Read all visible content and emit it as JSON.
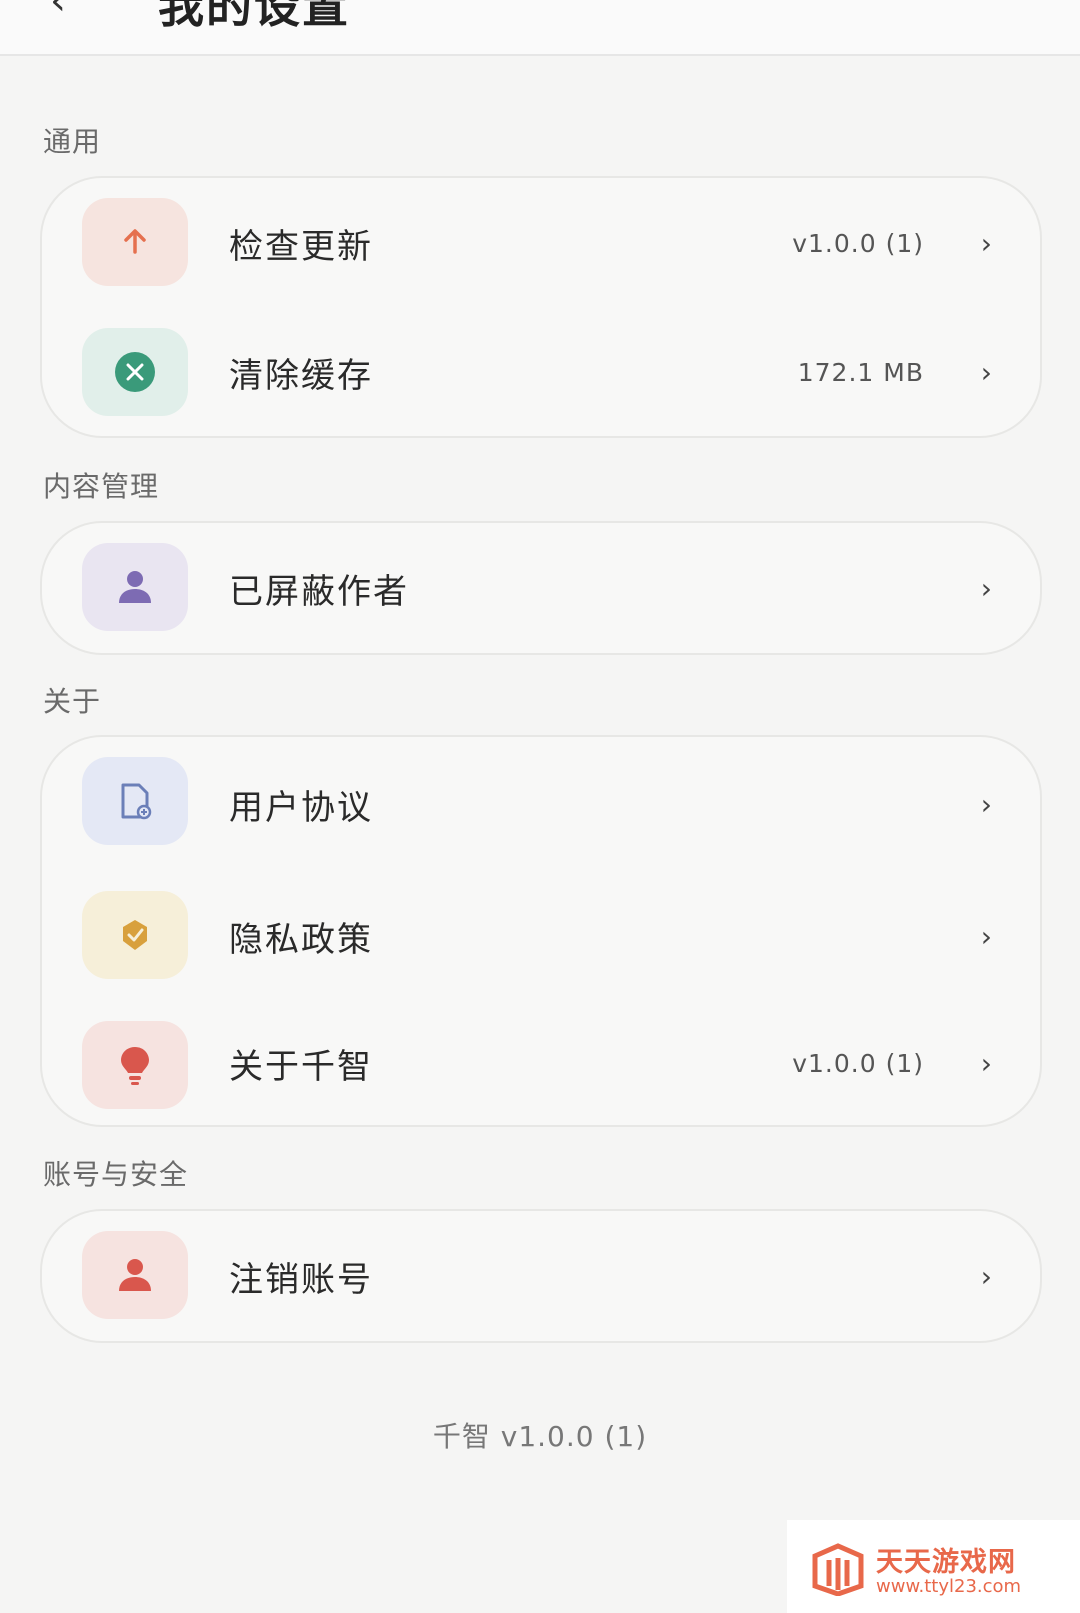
{
  "header": {
    "back_icon": "back-arrow-icon",
    "title": "我的设置"
  },
  "sections": [
    {
      "label": "通用",
      "items": [
        {
          "label": "检查更新",
          "value": "v1.0.0 (1)",
          "icon": "arrow-up-icon",
          "icon_color": "#e5704f",
          "bg": "#f6e4df"
        },
        {
          "label": "清除缓存",
          "value": "172.1 MB",
          "icon": "clear-circle-icon",
          "icon_color": "#3a9a7a",
          "bg": "#e1efea"
        }
      ]
    },
    {
      "label": "内容管理",
      "items": [
        {
          "label": "已屏蔽作者",
          "value": "",
          "icon": "person-icon",
          "icon_color": "#7d6bb3",
          "bg": "#e9e5f1"
        }
      ]
    },
    {
      "label": "关于",
      "items": [
        {
          "label": "用户协议",
          "value": "",
          "icon": "document-icon",
          "icon_color": "#6b7fb8",
          "bg": "#e4e8f5"
        },
        {
          "label": "隐私政策",
          "value": "",
          "icon": "shield-check-icon",
          "icon_color": "#d8a03d",
          "bg": "#f6efd9"
        },
        {
          "label": "关于千智",
          "value": "v1.0.0 (1)",
          "icon": "lightbulb-icon",
          "icon_color": "#d9574d",
          "bg": "#f6e3e0"
        }
      ]
    },
    {
      "label": "账号与安全",
      "items": [
        {
          "label": "注销账号",
          "value": "",
          "icon": "person-icon",
          "icon_color": "#d9574d",
          "bg": "#f6e3e0"
        }
      ]
    }
  ],
  "chevron": "›",
  "footer_version": "千智 v1.0.0 (1)",
  "watermark": {
    "title": "天天游戏网",
    "url": "www.ttyl23.com"
  }
}
